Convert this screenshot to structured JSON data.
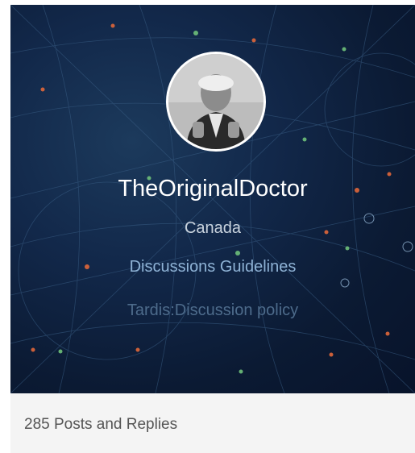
{
  "profile": {
    "username": "TheOriginalDoctor",
    "location": "Canada",
    "avatar_icon": "user-avatar-photo"
  },
  "links": {
    "guidelines": "Discussions Guidelines",
    "policy": "Tardis:Discussion policy"
  },
  "stats": {
    "posts_label": "285 Posts and Replies"
  },
  "colors": {
    "banner_background": "#0b1a33",
    "link": "#8fb3d6",
    "muted_link": "#4d6b8b",
    "footer_background": "#f4f4f4"
  }
}
